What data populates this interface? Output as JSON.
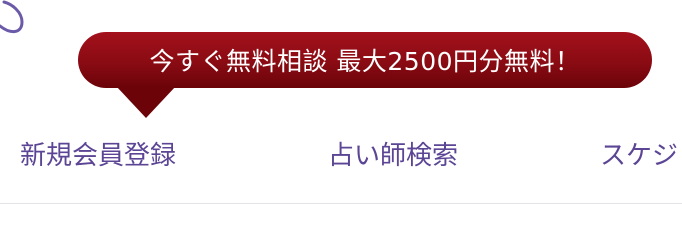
{
  "promo": {
    "text": "今すぐ無料相談 最大2500円分無料！"
  },
  "nav": {
    "items": [
      {
        "label": "新規会員登録"
      },
      {
        "label": "占い師検索"
      },
      {
        "label": "スケジ"
      }
    ]
  },
  "colors": {
    "promo_background": "#8a0b13",
    "nav_text": "#5b4594"
  }
}
